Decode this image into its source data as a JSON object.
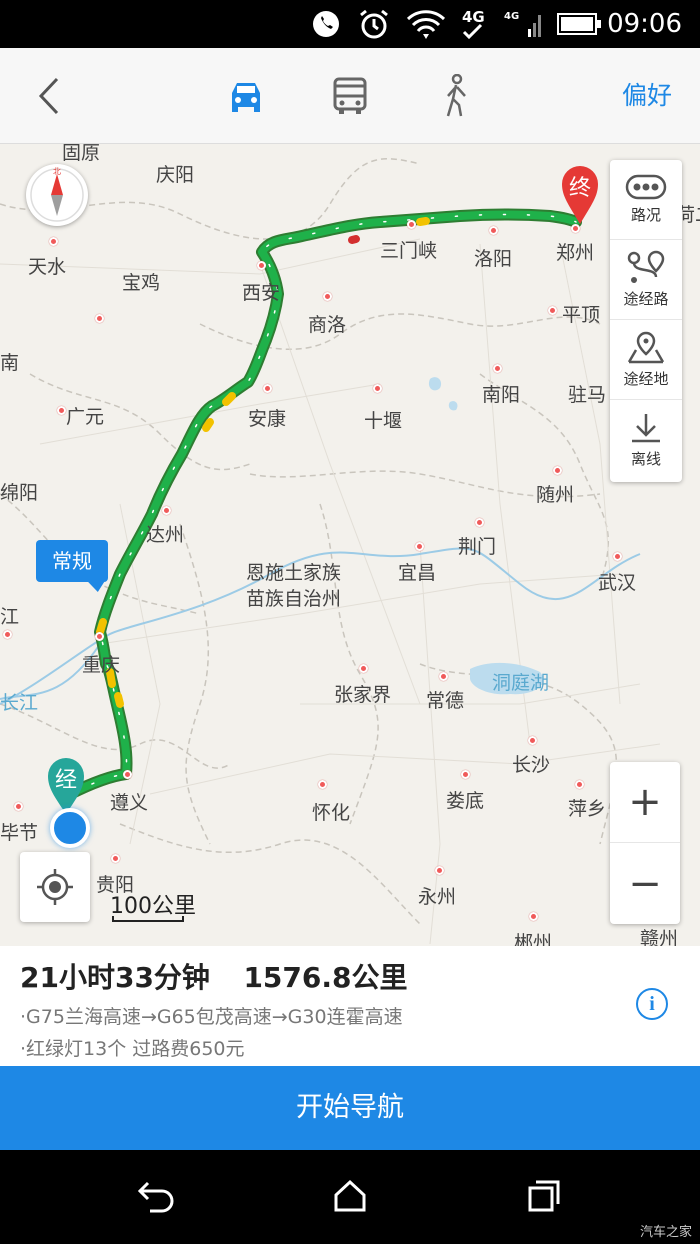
{
  "status_bar": {
    "time": "09:06",
    "network": "4G",
    "icons": [
      "wifi-calling-icon",
      "alarm-icon",
      "wifi-icon",
      "4g-icon",
      "signal-icon",
      "battery-icon"
    ]
  },
  "app_bar": {
    "back_icon": "back-arrow-icon",
    "modes": [
      "car-icon",
      "bus-icon",
      "walk-icon"
    ],
    "selected_mode": "car",
    "preference_label": "偏好"
  },
  "map": {
    "cities": [
      {
        "id": "gyuan",
        "name": "固原"
      },
      {
        "id": "qingyang",
        "name": "庆阳"
      },
      {
        "id": "tianshui",
        "name": "天水"
      },
      {
        "id": "baoji",
        "name": "宝鸡"
      },
      {
        "id": "xian",
        "name": "西安"
      },
      {
        "id": "shangluo",
        "name": "商洛"
      },
      {
        "id": "sanmenxia",
        "name": "三门峡"
      },
      {
        "id": "luoyang",
        "name": "洛阳"
      },
      {
        "id": "zhengzhou",
        "name": "郑州"
      },
      {
        "id": "pingding",
        "name": "平顶"
      },
      {
        "id": "nanyang",
        "name": "南阳"
      },
      {
        "id": "zhuma",
        "name": "驻马"
      },
      {
        "id": "guangyuan",
        "name": "广元"
      },
      {
        "id": "ankang",
        "name": "安康"
      },
      {
        "id": "shiyan",
        "name": "十堰"
      },
      {
        "id": "mianyang",
        "name": "绵阳"
      },
      {
        "id": "suizhou",
        "name": "随州"
      },
      {
        "id": "dazhou",
        "name": "达州"
      },
      {
        "id": "jingmen",
        "name": "荆门"
      },
      {
        "id": "enshi",
        "name": "恩施土家族"
      },
      {
        "id": "enshi2",
        "name": "苗族自治州"
      },
      {
        "id": "yichang",
        "name": "宜昌"
      },
      {
        "id": "wuhan",
        "name": "武汉"
      },
      {
        "id": "chongqing",
        "name": "重庆"
      },
      {
        "id": "zhangjiajie",
        "name": "张家界"
      },
      {
        "id": "changde",
        "name": "常德"
      },
      {
        "id": "changsha",
        "name": "长沙"
      },
      {
        "id": "zunyi",
        "name": "遵义"
      },
      {
        "id": "huaihua",
        "name": "怀化"
      },
      {
        "id": "loudi",
        "name": "娄底"
      },
      {
        "id": "pingxiang",
        "name": "萍乡"
      },
      {
        "id": "bijie",
        "name": "毕节"
      },
      {
        "id": "guiyang",
        "name": "贵阳"
      },
      {
        "id": "yongzhou",
        "name": "永州"
      },
      {
        "id": "chenzhou",
        "name": "郴州"
      },
      {
        "id": "ganzhou",
        "name": "赣州"
      },
      {
        "id": "nan",
        "name": "南"
      },
      {
        "id": "jiang",
        "name": "江"
      },
      {
        "id": "he",
        "name": "荷二"
      }
    ],
    "water_labels": {
      "dongting": "洞庭湖",
      "changjiang": "长江"
    },
    "route_tag": "常规",
    "start_marker": "经",
    "end_marker": "终",
    "scale_label": "100公里"
  },
  "tools": [
    {
      "icon": "traffic-icon",
      "label": "路况"
    },
    {
      "icon": "waypoint-route-icon",
      "label": "途经路"
    },
    {
      "icon": "waypoint-place-icon",
      "label": "途经地"
    },
    {
      "icon": "download-icon",
      "label": "离线"
    }
  ],
  "zoom": {
    "in": "+",
    "out": "−"
  },
  "route_info": {
    "duration": "21小时33分钟",
    "distance": "1576.8公里",
    "roads": "·G75兰海高速→G65包茂高速→G30连霍高速",
    "extra": "·红绿灯13个  过路费650元",
    "info_icon": "i"
  },
  "start_button": "开始导航",
  "watermark": "汽车之家",
  "colors": {
    "accent": "#1e88e5",
    "route": "#1fb14a",
    "route_outline": "#2e7d32"
  }
}
